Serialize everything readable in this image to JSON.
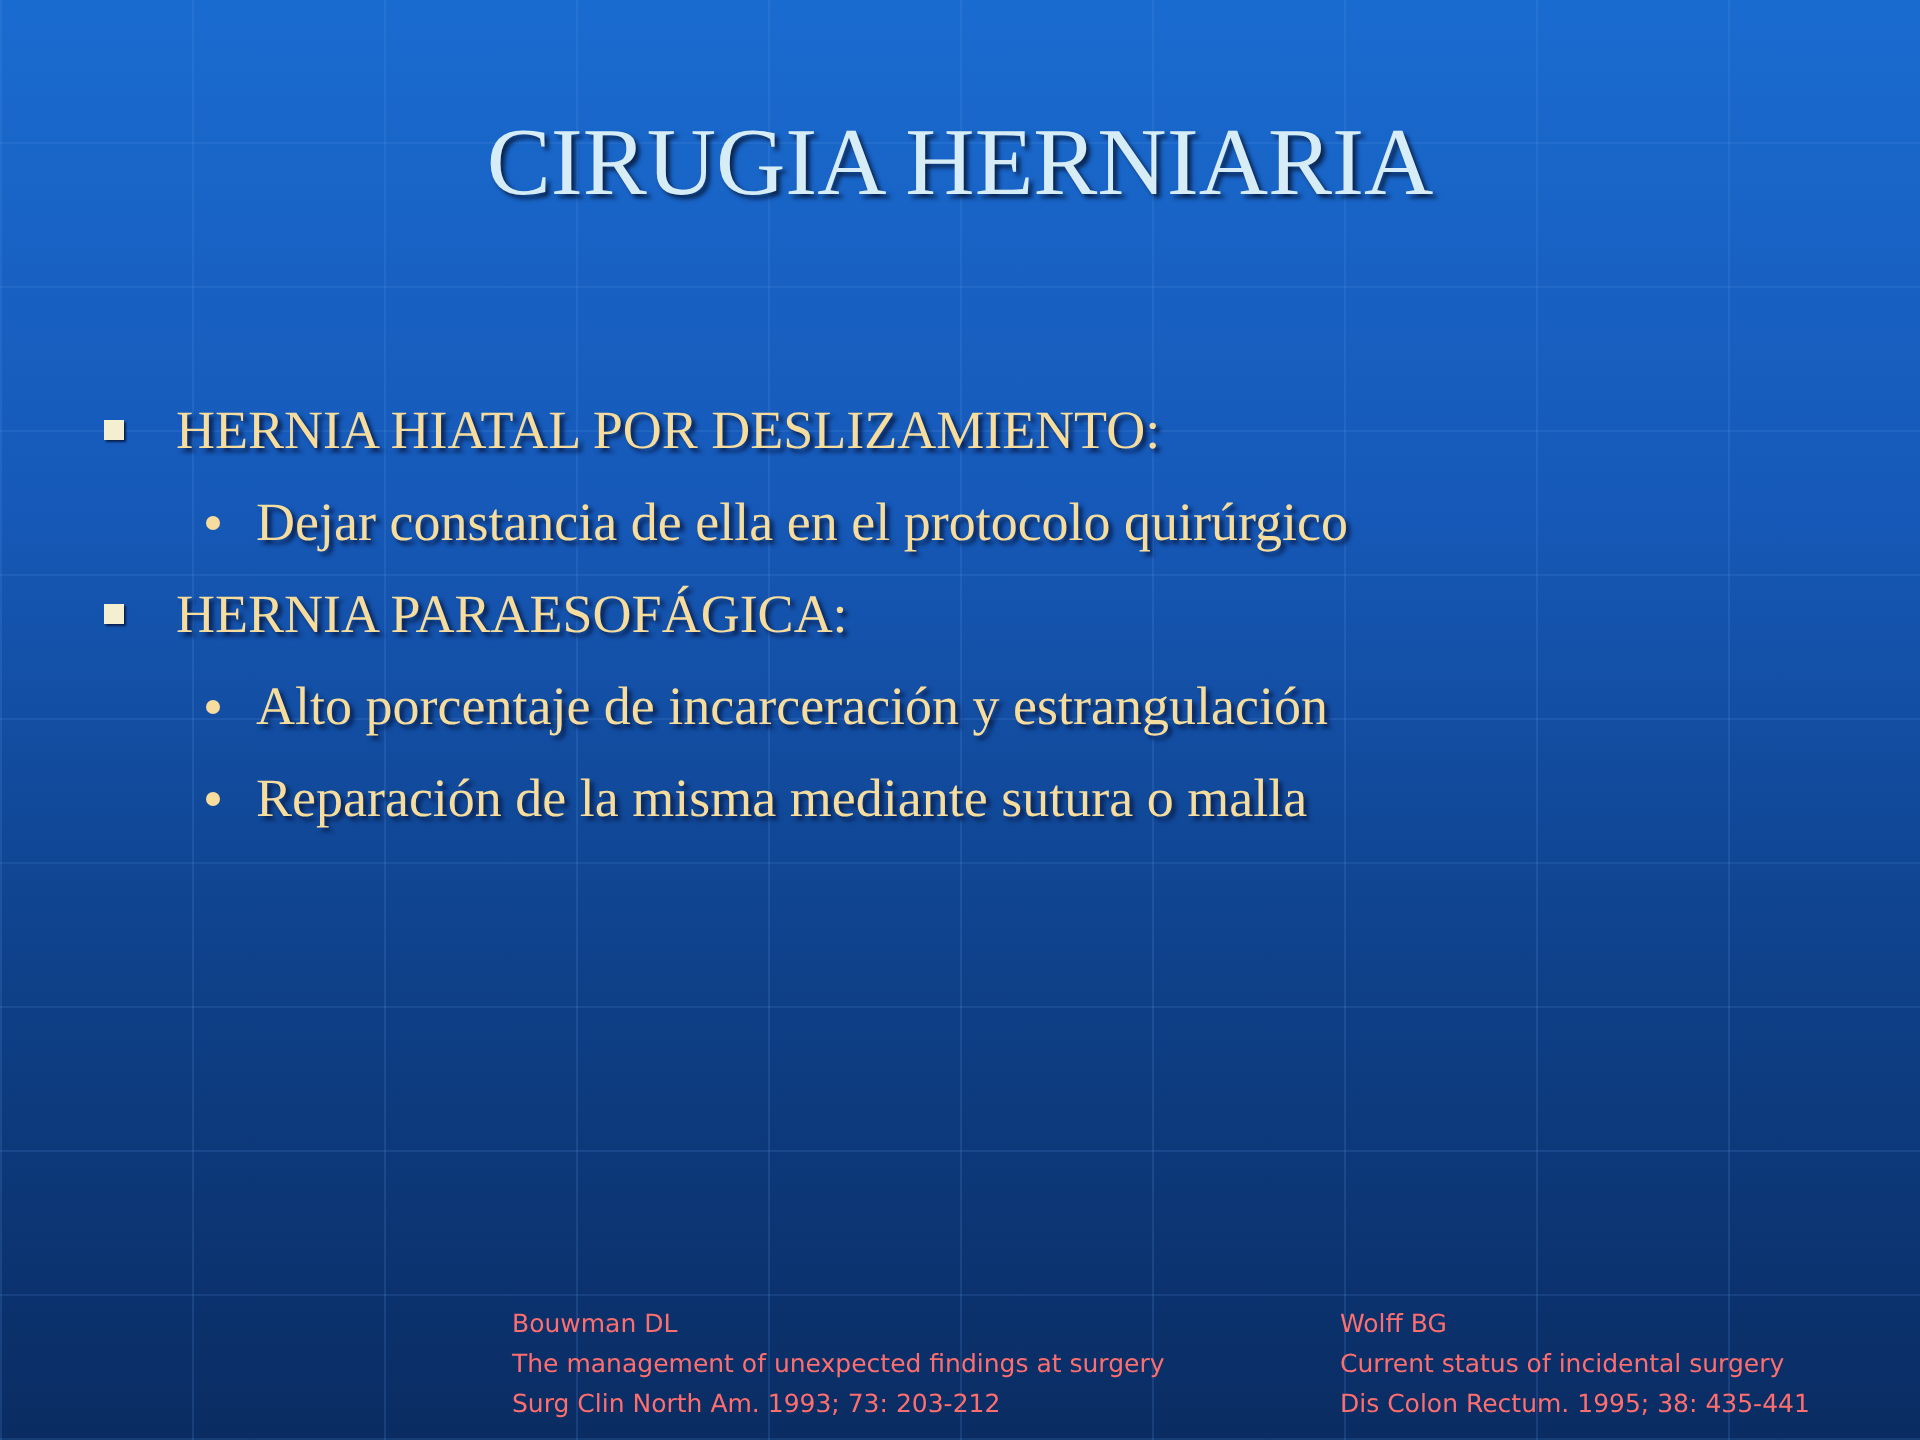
{
  "title": "CIRUGIA HERNIARIA",
  "bullets": [
    {
      "text": "HERNIA HIATAL POR DESLIZAMIENTO:",
      "children": [
        {
          "text": "Dejar constancia de ella en el protocolo quirúrgico"
        }
      ]
    },
    {
      "text": "HERNIA PARAESOFÁGICA:",
      "children": [
        {
          "text": "Alto porcentaje de incarceración y estrangulación"
        },
        {
          "text": "Reparación de la misma mediante sutura o malla"
        }
      ]
    }
  ],
  "references": [
    {
      "lines": [
        "Bouwman DL",
        "The management of unexpected findings at surgery",
        "Surg Clin North Am. 1993; 73: 203-212"
      ]
    },
    {
      "lines": [
        "Wolff BG",
        "Current status of incidental surgery",
        "Dis Colon Rectum. 1995; 38: 435-441"
      ]
    }
  ]
}
